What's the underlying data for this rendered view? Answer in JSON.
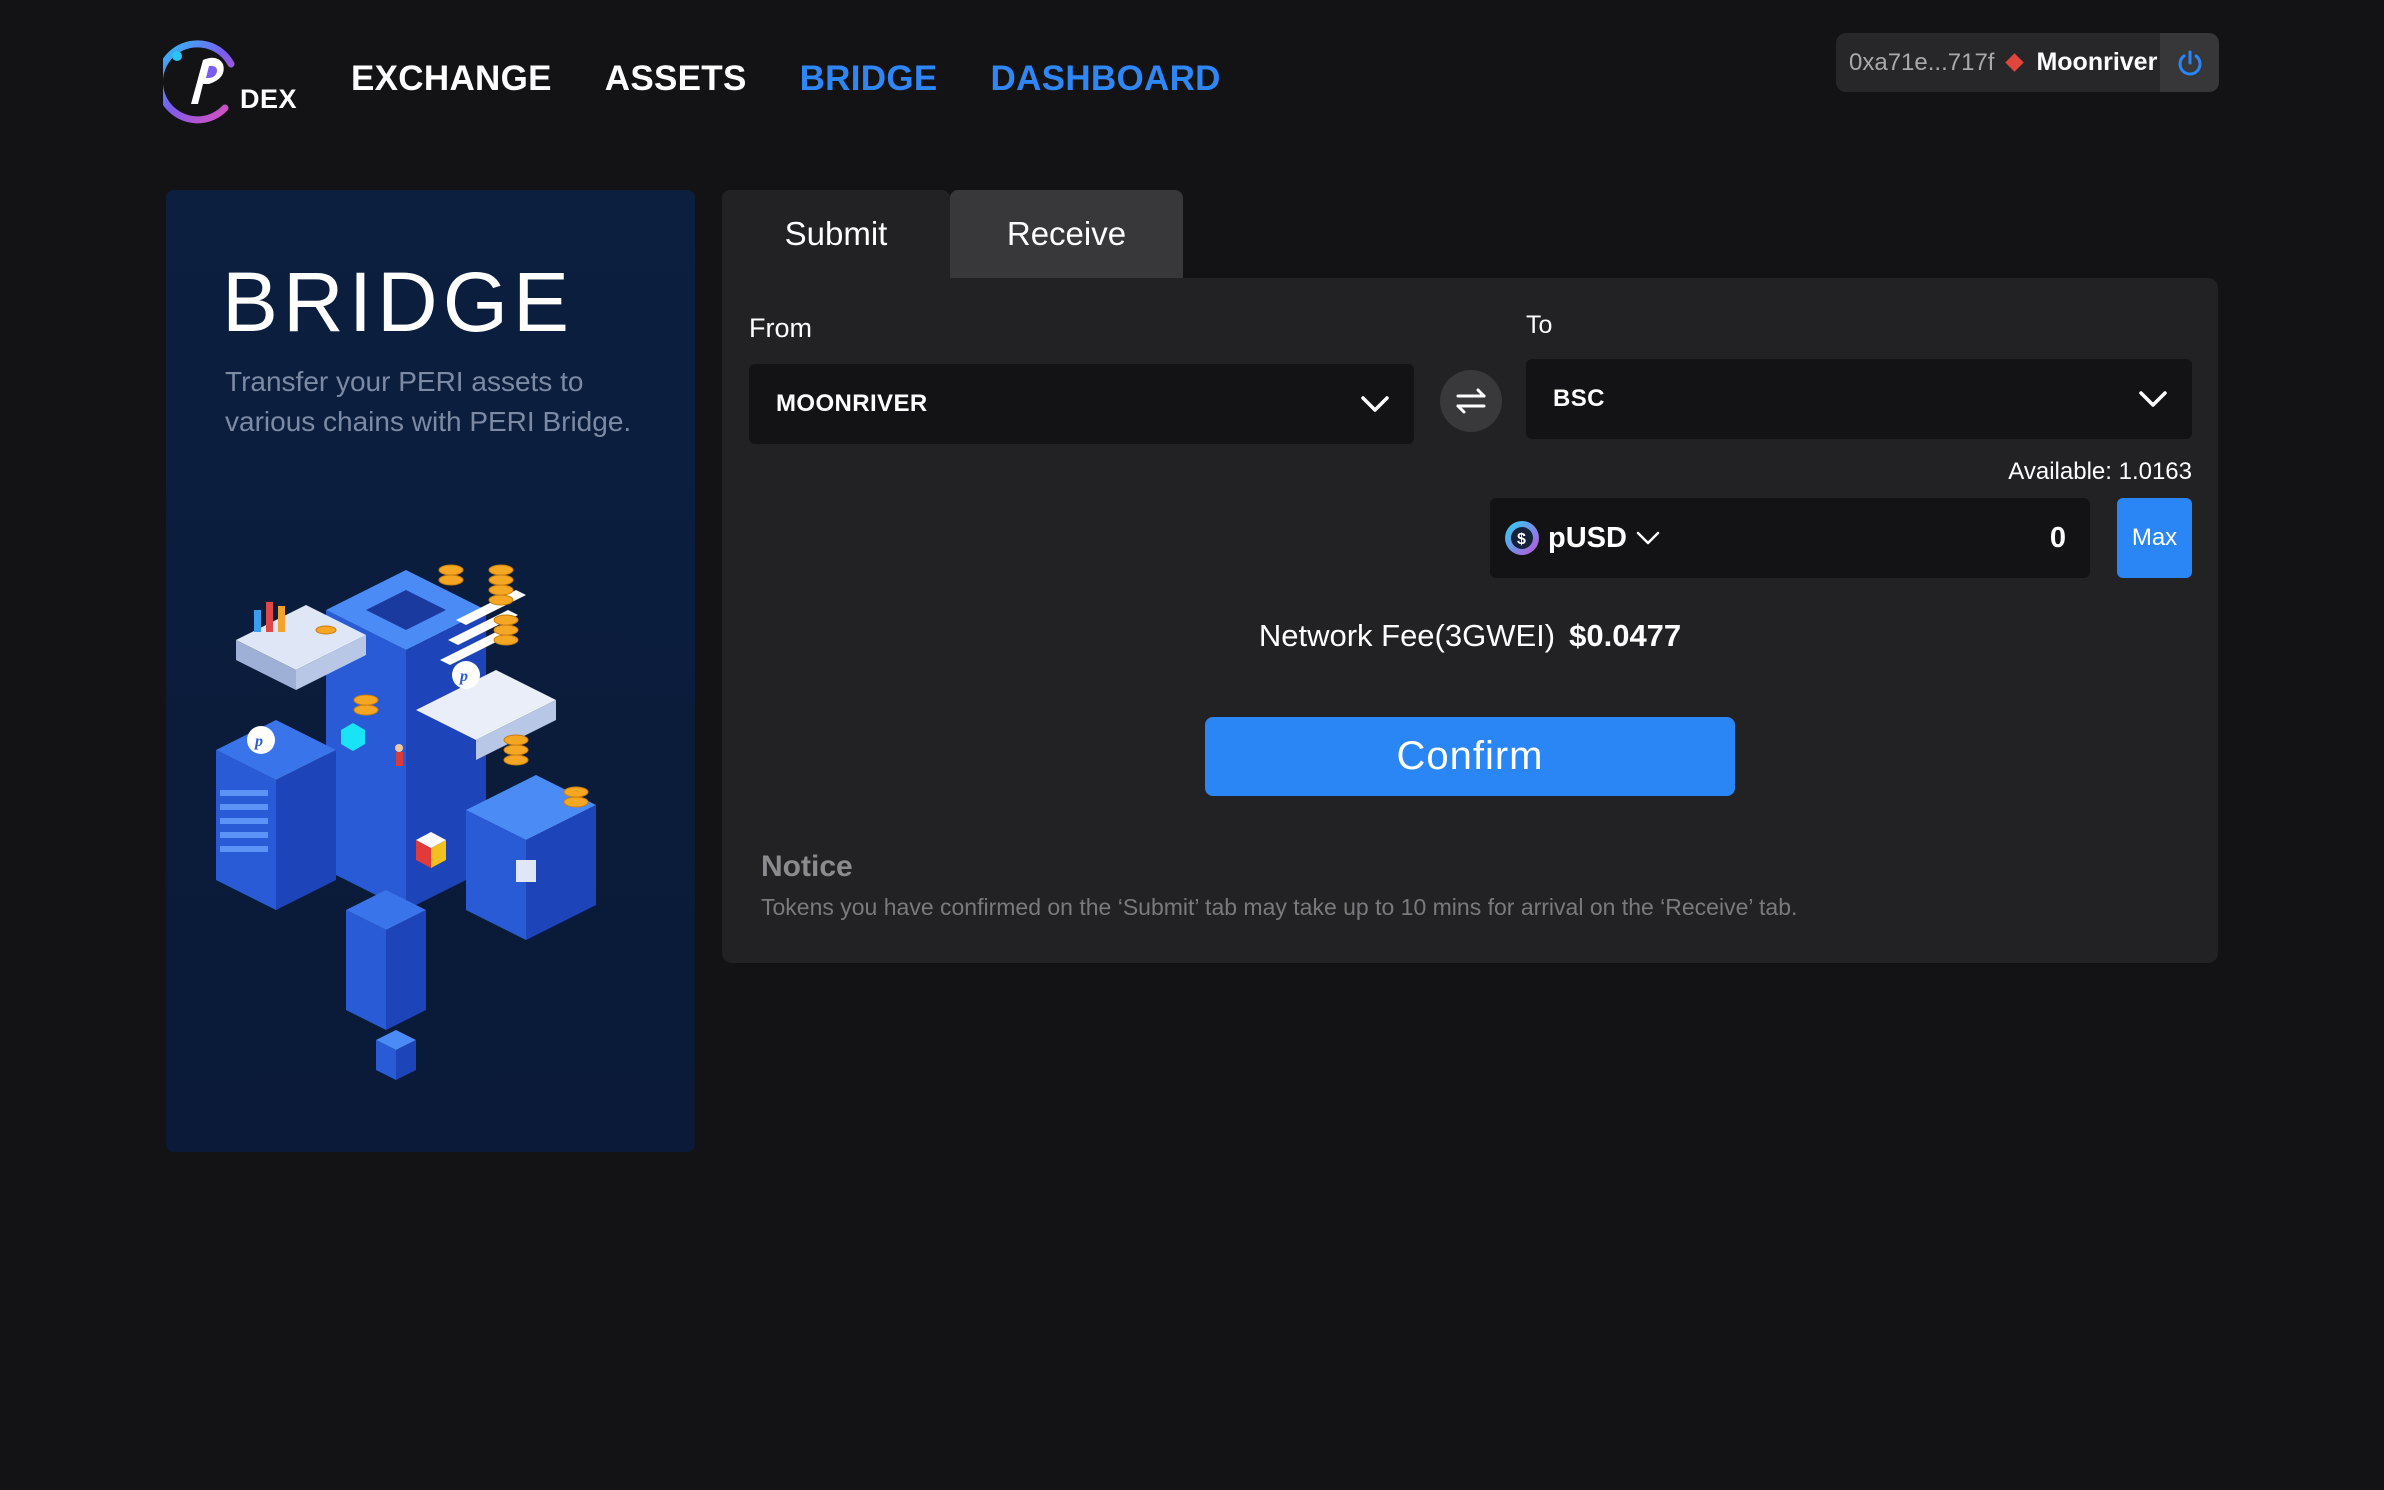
{
  "header": {
    "logo_text": "DEX",
    "nav": [
      {
        "label": "EXCHANGE"
      },
      {
        "label": "ASSETS"
      },
      {
        "label": "BRIDGE"
      },
      {
        "label": "DASHBOARD"
      }
    ],
    "wallet": {
      "address": "0xa71e...717f",
      "network": "Moonriver",
      "network_color": "#e0463e",
      "power_icon": "power-icon"
    }
  },
  "left_panel": {
    "title": "BRIDGE",
    "description": "Transfer your PERI assets to various chains with PERI Bridge."
  },
  "tabs": [
    {
      "label": "Submit"
    },
    {
      "label": "Receive"
    }
  ],
  "form": {
    "from_label": "From",
    "from_value": "MOONRIVER",
    "to_label": "To",
    "to_value": "BSC",
    "available": "Available: 1.0163",
    "token": "pUSD",
    "amount": "0",
    "max_label": "Max",
    "fee_label": "Network Fee(3GWEI)",
    "fee_value": "$0.0477",
    "confirm_label": "Confirm"
  },
  "notice": {
    "title": "Notice",
    "text": "Tokens you have confirmed on the ‘Submit’ tab may take up to 10 mins for arrival on the ‘Receive’ tab."
  },
  "colors": {
    "background": "#131315",
    "card": "#222224",
    "accent": "#2b86f5",
    "nav_active": "#2f86f5"
  }
}
